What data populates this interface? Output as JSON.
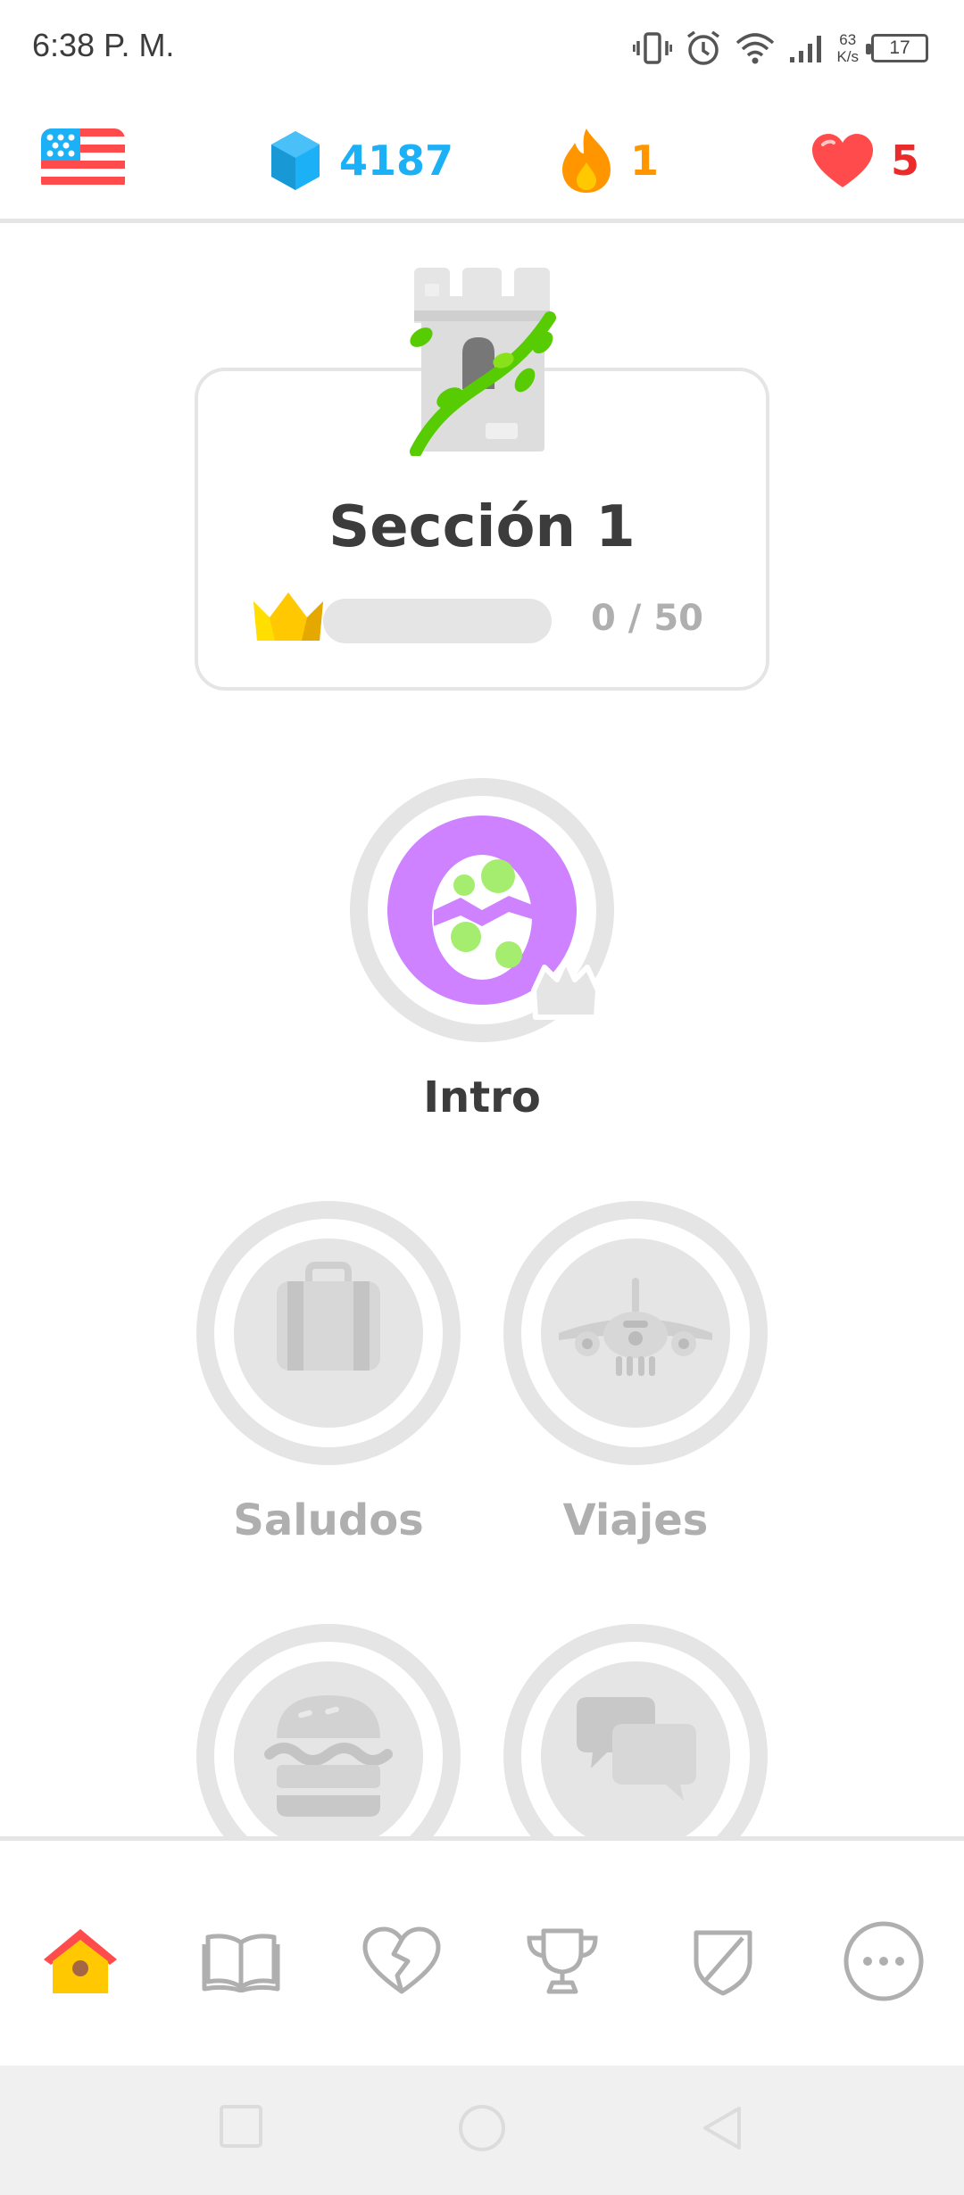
{
  "status_bar": {
    "time": "6:38 P. M.",
    "net_speed_value": "63",
    "net_speed_unit": "K/s",
    "battery": "17"
  },
  "top_stats": {
    "language_flag": "us-flag-icon",
    "gems": "4187",
    "streak": "1",
    "hearts": "5",
    "colors": {
      "gems": "#1cb0f6",
      "streak": "#ff9600",
      "hearts": "#ea2b2b"
    }
  },
  "section": {
    "title": "Sección 1",
    "progress_text": "0 / 50",
    "progress_value": 0
  },
  "skills": [
    {
      "label": "Intro",
      "icon": "egg-icon",
      "state": "active"
    },
    {
      "label": "Saludos",
      "icon": "suitcase-icon",
      "state": "locked"
    },
    {
      "label": "Viajes",
      "icon": "airplane-icon",
      "state": "locked"
    },
    {
      "label": "",
      "icon": "burger-icon",
      "state": "locked"
    },
    {
      "label": "",
      "icon": "chat-bubbles-icon",
      "state": "locked"
    }
  ],
  "bottom_nav": [
    {
      "name": "learn",
      "icon": "home-icon",
      "selected": true
    },
    {
      "name": "stories",
      "icon": "book-icon",
      "selected": false
    },
    {
      "name": "practice",
      "icon": "broken-heart-icon",
      "selected": false
    },
    {
      "name": "leaderboard",
      "icon": "trophy-icon",
      "selected": false
    },
    {
      "name": "shield",
      "icon": "shield-icon",
      "selected": false
    },
    {
      "name": "more",
      "icon": "more-icon",
      "selected": false
    }
  ]
}
